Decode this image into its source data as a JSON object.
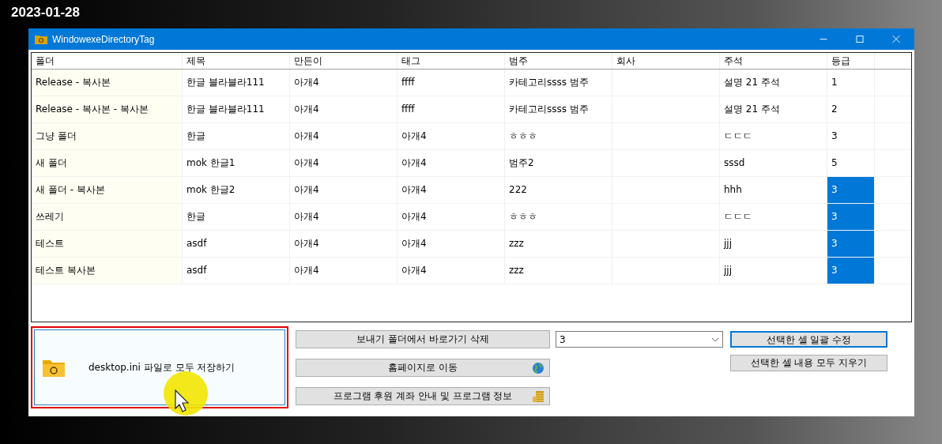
{
  "desktop": {
    "date": "2023-01-28"
  },
  "window": {
    "title": "WindowexeDirectoryTag"
  },
  "table": {
    "columns": [
      "폴더",
      "제목",
      "만든이",
      "태그",
      "범주",
      "회사",
      "주석",
      "등급"
    ],
    "rows": [
      {
        "cells": [
          "Release - 복사본",
          "한글 블라블라111",
          "아개4",
          "ffff",
          "카테고리ssss 범주",
          "",
          " 설명 21 주석",
          "1"
        ],
        "grade_selected": false
      },
      {
        "cells": [
          "Release - 복사본 - 복사본",
          "한글 블라블라111",
          "아개4",
          "ffff",
          "카테고리ssss 범주",
          "",
          " 설명 21 주석",
          "2"
        ],
        "grade_selected": false
      },
      {
        "cells": [
          "그냥 폴더",
          "한글",
          "아개4",
          "아개4",
          "ㅎㅎㅎ",
          "",
          "ㄷㄷㄷ",
          "3"
        ],
        "grade_selected": false
      },
      {
        "cells": [
          "새 폴더",
          "mok 한글1",
          "아개4",
          "아개4",
          "범주2",
          "",
          "sssd",
          "5"
        ],
        "grade_selected": false
      },
      {
        "cells": [
          "새 폴더 - 복사본",
          "mok 한글2",
          "아개4",
          "아개4",
          "222",
          "",
          "hhh",
          "3"
        ],
        "grade_selected": true
      },
      {
        "cells": [
          "쓰레기",
          "한글",
          "아개4",
          "아개4",
          "ㅎㅎㅎ",
          "",
          "ㄷㄷㄷ",
          "3"
        ],
        "grade_selected": true
      },
      {
        "cells": [
          "테스트",
          "asdf",
          "아개4",
          "아개4",
          "zzz",
          "",
          "jjj",
          "3"
        ],
        "grade_selected": true
      },
      {
        "cells": [
          "테스트 복사본",
          "asdf",
          "아개4",
          "아개4",
          "zzz",
          "",
          "jjj",
          "3"
        ],
        "grade_selected": true
      }
    ]
  },
  "save_button": {
    "label": "desktop.ini 파일로 모두 저장하기"
  },
  "middle_buttons": [
    {
      "label": "보내기 폴더에서 바로가기 삭제",
      "kind": "plain"
    },
    {
      "label": "홈페이지로 이동",
      "kind": "web"
    },
    {
      "label": "프로그램 후원 계좌 안내 및 프로그램 정보",
      "kind": "info"
    }
  ],
  "grade_combo": {
    "value": "3"
  },
  "right_buttons": [
    {
      "label": "선택한 셀 일괄 수정",
      "focused": true
    },
    {
      "label": "선택한 셀 내용 모두 지우기",
      "focused": false
    }
  ]
}
